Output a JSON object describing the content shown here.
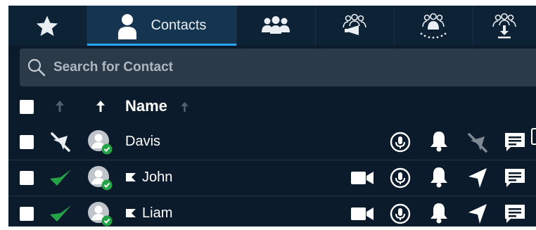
{
  "tabs": {
    "favorites_icon": "star-icon",
    "contacts_label": "Contacts",
    "groups_icon": "group-icon",
    "broadcast_icon": "broadcast-icon",
    "conference_icon": "conference-icon",
    "download_icon": "download-icon"
  },
  "search": {
    "placeholder": "Search for Contact"
  },
  "table": {
    "name_header": "Name",
    "rows": [
      {
        "name": "Davis",
        "status": "offline",
        "flag": false
      },
      {
        "name": "John",
        "status": "online",
        "flag": true
      },
      {
        "name": "Liam",
        "status": "online",
        "flag": true
      }
    ]
  },
  "colors": {
    "background": "#0b1b2b",
    "active_tab": "#15344f",
    "accent": "#2aa7f2",
    "online_green": "#22a447"
  }
}
